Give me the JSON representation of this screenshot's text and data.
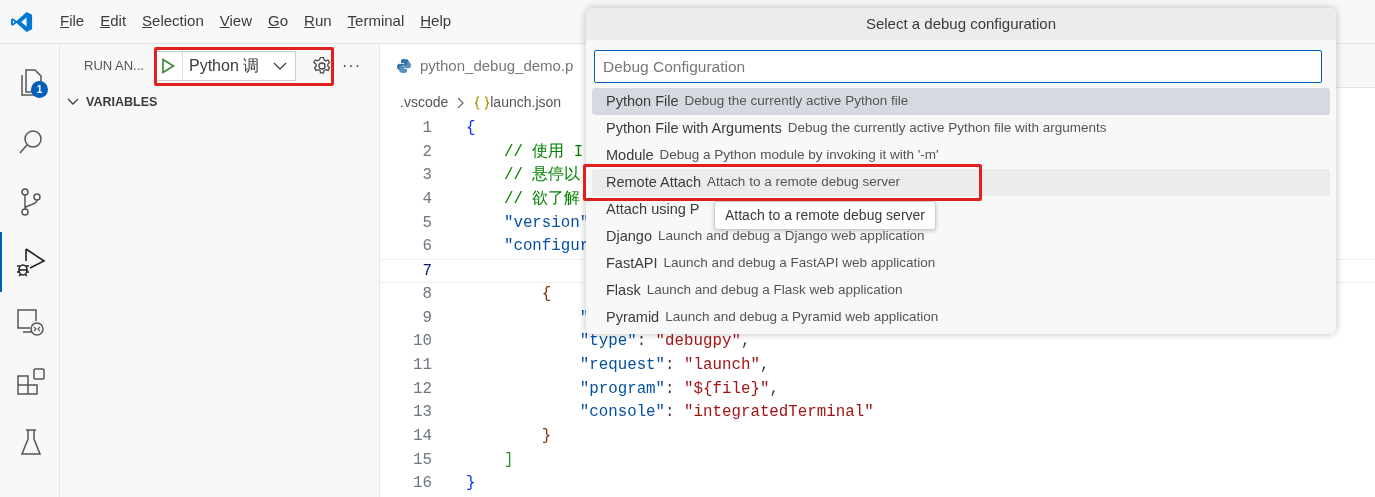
{
  "menu": [
    "File",
    "Edit",
    "Selection",
    "View",
    "Go",
    "Run",
    "Terminal",
    "Help"
  ],
  "activity_bar": [
    {
      "kind": "explorer",
      "selected": false,
      "badge": "1"
    },
    {
      "kind": "search",
      "selected": false
    },
    {
      "kind": "source-control",
      "selected": false
    },
    {
      "kind": "run-debug",
      "selected": true
    },
    {
      "kind": "remote",
      "selected": false
    },
    {
      "kind": "extensions",
      "selected": false
    },
    {
      "kind": "testing",
      "selected": false
    }
  ],
  "sidebar": {
    "title": "RUN AN...",
    "debug_toolbar": {
      "configuration": "Python 调",
      "annotated": true,
      "more": "···"
    },
    "section": {
      "label": "VARIABLES",
      "expanded": true
    }
  },
  "editor": {
    "tab": "python_debug_demo.p",
    "breadcrumbs": [
      ".vscode",
      "launch.json"
    ],
    "lines": [
      {
        "number": "1",
        "current": false,
        "tokens": [
          {
            "kind": "bracket1",
            "text": "{"
          }
        ]
      },
      {
        "number": "2",
        "current": false,
        "tokens": [
          {
            "kind": "comment",
            "text": "    // 使用 I"
          }
        ]
      },
      {
        "number": "3",
        "current": false,
        "tokens": [
          {
            "kind": "comment",
            "text": "    // 悬停以"
          }
        ]
      },
      {
        "number": "4",
        "current": false,
        "tokens": [
          {
            "kind": "comment",
            "text": "    // 欲了解"
          }
        ]
      },
      {
        "number": "5",
        "current": false,
        "tokens": [
          {
            "kind": "key",
            "text": "    \"version\""
          }
        ]
      },
      {
        "number": "6",
        "current": false,
        "tokens": [
          {
            "kind": "key",
            "text": "    \"configur"
          }
        ]
      },
      {
        "number": "7",
        "current": true
      },
      {
        "number": "8",
        "current": false,
        "tokens": [
          {
            "kind": "bracket3",
            "text": "        {"
          }
        ]
      },
      {
        "number": "9",
        "current": false,
        "tokens": [
          {
            "kind": "key",
            "text": "            \""
          }
        ]
      },
      {
        "number": "10",
        "current": false,
        "tokens": [
          {
            "kind": "key",
            "text": "            \"type\""
          },
          {
            "kind": "punct",
            "text": ": "
          },
          {
            "kind": "string",
            "text": "\"debugpy\""
          },
          {
            "kind": "punct",
            "text": ","
          }
        ]
      },
      {
        "number": "11",
        "current": false,
        "tokens": [
          {
            "kind": "key",
            "text": "            \"request\""
          },
          {
            "kind": "punct",
            "text": ": "
          },
          {
            "kind": "string",
            "text": "\"launch\""
          },
          {
            "kind": "punct",
            "text": ","
          }
        ]
      },
      {
        "number": "12",
        "current": false,
        "tokens": [
          {
            "kind": "key",
            "text": "            \"program\""
          },
          {
            "kind": "punct",
            "text": ": "
          },
          {
            "kind": "string",
            "text": "\"${file}\""
          },
          {
            "kind": "punct",
            "text": ","
          }
        ]
      },
      {
        "number": "13",
        "current": false,
        "tokens": [
          {
            "kind": "key",
            "text": "            \"console\""
          },
          {
            "kind": "punct",
            "text": ": "
          },
          {
            "kind": "string",
            "text": "\"integratedTerminal\""
          }
        ]
      },
      {
        "number": "14",
        "current": false,
        "tokens": [
          {
            "kind": "bracket3",
            "text": "        }"
          }
        ]
      },
      {
        "number": "15",
        "current": false,
        "tokens": [
          {
            "kind": "bracket2",
            "text": "    ]"
          }
        ]
      },
      {
        "number": "16",
        "current": false,
        "tokens": [
          {
            "kind": "bracket1",
            "text": "}"
          }
        ]
      }
    ]
  },
  "quick_pick": {
    "title": "Select a debug configuration",
    "placeholder": "Debug Configuration",
    "items": [
      {
        "label": "Python File",
        "description": "Debug the currently active Python file",
        "selected": true,
        "hovered": false,
        "annotated": false
      },
      {
        "label": "Python File with Arguments",
        "description": "Debug the currently active Python file with arguments",
        "selected": false,
        "hovered": false,
        "annotated": false
      },
      {
        "label": "Module",
        "description": "Debug a Python module by invoking it with '-m'",
        "selected": false,
        "hovered": false,
        "annotated": false
      },
      {
        "label": "Remote Attach",
        "description": "Attach to a remote debug server",
        "selected": false,
        "hovered": true,
        "annotated": true
      },
      {
        "label": "Attach using P",
        "selected": false,
        "hovered": false,
        "annotated": false
      },
      {
        "label": "Django",
        "description": "Launch and debug a Django web application",
        "selected": false,
        "hovered": false,
        "annotated": false
      },
      {
        "label": "FastAPI",
        "description": "Launch and debug a FastAPI web application",
        "selected": false,
        "hovered": false,
        "annotated": false
      },
      {
        "label": "Flask",
        "description": "Launch and debug a Flask web application",
        "selected": false,
        "hovered": false,
        "annotated": false
      },
      {
        "label": "Pyramid",
        "description": "Launch and debug a Pyramid web application",
        "selected": false,
        "hovered": false,
        "annotated": false
      }
    ],
    "tooltip": "Attach to a remote debug server"
  }
}
